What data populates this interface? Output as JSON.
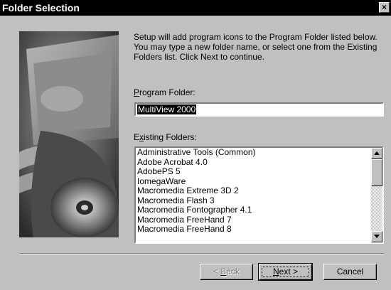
{
  "window": {
    "title": "Folder Selection",
    "close_glyph": "×"
  },
  "intro_text": "Setup will add program icons to the Program Folder listed below. You may type a new folder name, or select one from the Existing Folders list.  Click Next to continue.",
  "program_folder": {
    "label_mnemonic": "P",
    "label_rest": "rogram Folder:",
    "value": "MultiView 2000"
  },
  "existing_folders": {
    "label_pre": "E",
    "label_mnemonic": "x",
    "label_rest": "isting Folders:",
    "items": [
      "Administrative Tools (Common)",
      "Adobe Acrobat 4.0",
      "AdobePS 5",
      "IomegaWare",
      "Macromedia Extreme 3D 2",
      "Macromedia Flash 3",
      "Macromedia Fontographer 4.1",
      "Macromedia FreeHand 7",
      "Macromedia FreeHand 8"
    ]
  },
  "buttons": {
    "back": {
      "pre": "< ",
      "mnemonic": "B",
      "rest": "ack"
    },
    "next": {
      "mnemonic": "N",
      "rest": "ext >"
    },
    "cancel": "Cancel"
  },
  "icons": {
    "close": "close-icon",
    "scroll_up": "scroll-up-arrow-icon",
    "scroll_down": "scroll-down-arrow-icon"
  }
}
